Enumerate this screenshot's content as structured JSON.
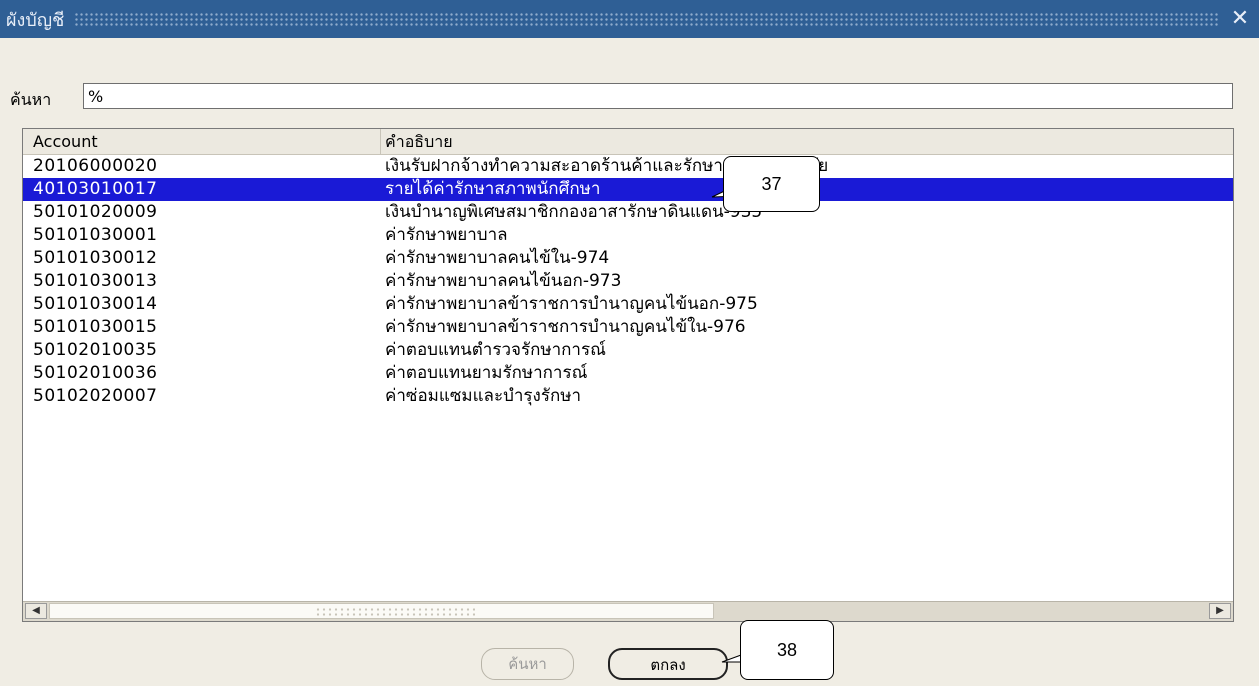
{
  "window": {
    "title": "ผังบัญชี",
    "close_glyph": "✕"
  },
  "search": {
    "label": "ค้นหา",
    "value": "%"
  },
  "table": {
    "headers": {
      "account": "Account",
      "description": "คำอธิบาย"
    },
    "rows": [
      {
        "account": "20106000020",
        "description": "เงินรับฝากจ้างทำความสะอาดร้านค้าและรักษาความปลอดภัย",
        "selected": false
      },
      {
        "account": "40103010017",
        "description": "รายได้ค่ารักษาสภาพนักศึกษา",
        "selected": true
      },
      {
        "account": "50101020009",
        "description": "เงินบำนาญพิเศษสมาชิกกองอาสารักษาดินแดน-935",
        "selected": false
      },
      {
        "account": "50101030001",
        "description": "ค่ารักษาพยาบาล",
        "selected": false
      },
      {
        "account": "50101030012",
        "description": "ค่ารักษาพยาบาลคนไข้ใน-974",
        "selected": false
      },
      {
        "account": "50101030013",
        "description": "ค่ารักษาพยาบาลคนไข้นอก-973",
        "selected": false
      },
      {
        "account": "50101030014",
        "description": "ค่ารักษาพยาบาลข้าราชการบำนาญคนไข้นอก-975",
        "selected": false
      },
      {
        "account": "50101030015",
        "description": "ค่ารักษาพยาบาลข้าราชการบำนาญคนไข้ใน-976",
        "selected": false
      },
      {
        "account": "50102010035",
        "description": "ค่าตอบแทนตำรวจรักษาการณ์",
        "selected": false
      },
      {
        "account": "50102010036",
        "description": "ค่าตอบแทนยามรักษาการณ์",
        "selected": false
      },
      {
        "account": "50102020007",
        "description": "ค่าซ่อมแซมและบำรุงรักษา",
        "selected": false
      }
    ]
  },
  "buttons": {
    "find": "ค้นหา",
    "ok": "ตกลง"
  },
  "scroll": {
    "left_glyph": "◀",
    "right_glyph": "▶"
  },
  "callouts": {
    "step37": "37",
    "step38": "38"
  },
  "colors": {
    "title_bar": "#2f5f95",
    "selection": "#1a1ad6",
    "background": "#f0ede4"
  }
}
